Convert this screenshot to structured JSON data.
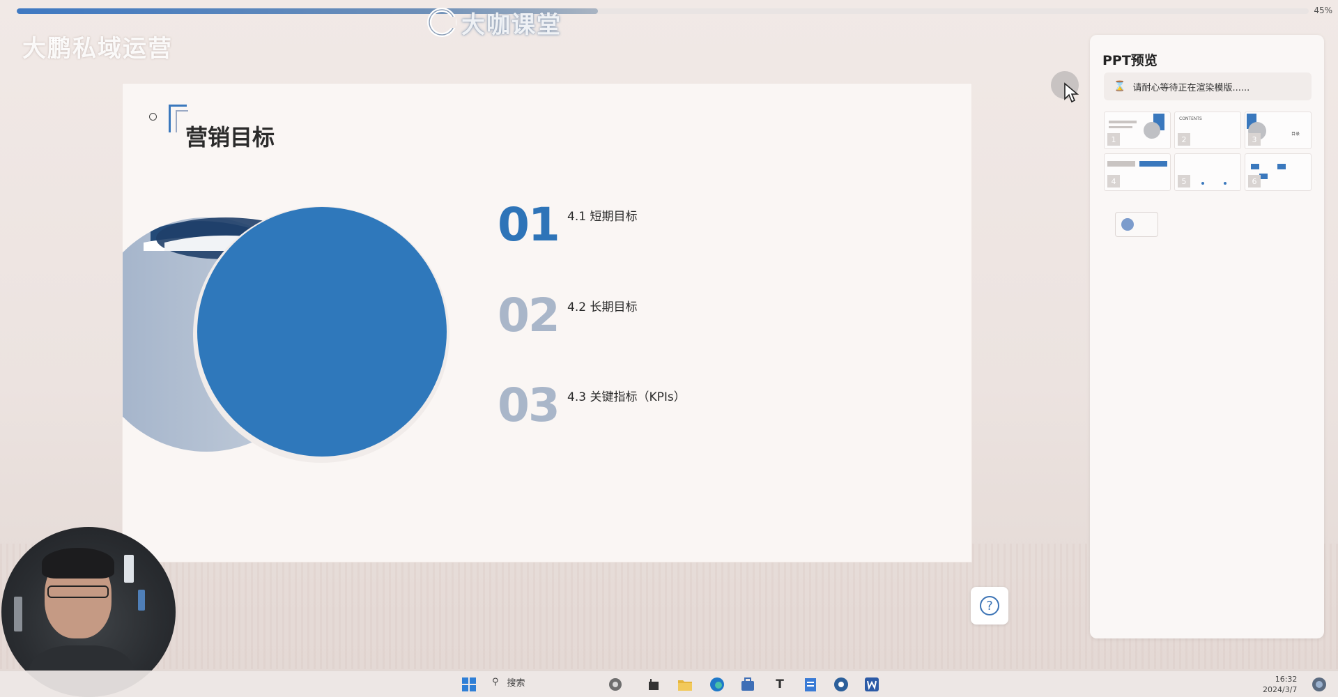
{
  "progress": {
    "percent_text": "45%",
    "value": 0.45
  },
  "watermark": {
    "text": "大咖课堂"
  },
  "header": {
    "ghost_title": "大鹏私域运营",
    "ghost_subtitle": ""
  },
  "slide": {
    "title": "营销目标",
    "items": [
      {
        "num": "01",
        "label": "4.1 短期目标"
      },
      {
        "num": "02",
        "label": "4.2 长期目标"
      },
      {
        "num": "03",
        "label": "4.3 关键指标（KPIs）"
      }
    ]
  },
  "preview": {
    "title": "PPT预览",
    "status": "请耐心等待正在渲染模版......",
    "thumb_numbers": [
      "1",
      "2",
      "3",
      "4",
      "5",
      "6"
    ],
    "thumb_texts": {
      "t2": "CONTENTS",
      "t3": "目录"
    }
  },
  "help": {
    "symbol": "?"
  },
  "taskbar": {
    "search_placeholder": "搜索",
    "text_app": "T",
    "time": "16:32",
    "date": "2024/3/7"
  },
  "colors": {
    "accent_blue": "#2e74b8",
    "muted_blue": "#a9b6c9",
    "slide_bg": "#faf6f4"
  }
}
